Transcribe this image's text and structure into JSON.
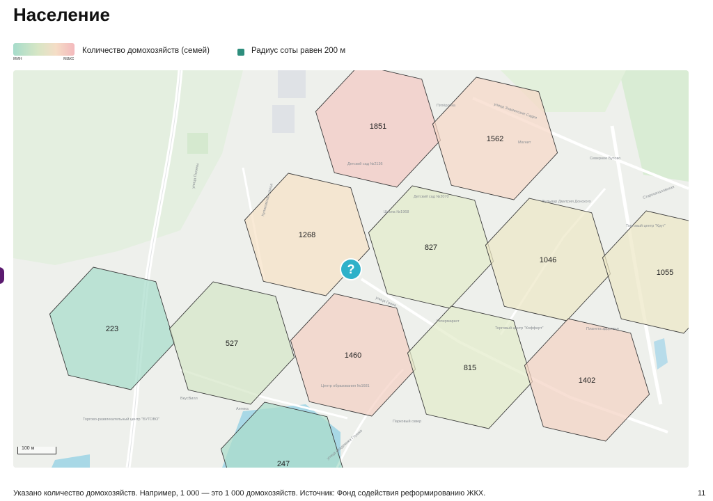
{
  "title": "Население",
  "legend": {
    "gradient_min": "мин",
    "gradient_max": "макс",
    "gradient_label": "Количество домохозяйств (семей)",
    "radius_label": "Радиус соты равен 200 м",
    "radius_color": "#2e8e7d"
  },
  "map": {
    "help_symbol": "?",
    "scale_label": "100 м",
    "hexes": [
      {
        "value": "1851",
        "color": "#f4c9c4"
      },
      {
        "value": "1562",
        "color": "#f6d8c8"
      },
      {
        "value": "1268",
        "color": "#f6e2c6"
      },
      {
        "value": "827",
        "color": "#e3ebcb"
      },
      {
        "value": "1046",
        "color": "#ede8c6"
      },
      {
        "value": "1055",
        "color": "#ede8c6"
      },
      {
        "value": "223",
        "color": "#a8dcca"
      },
      {
        "value": "527",
        "color": "#d6e6c8"
      },
      {
        "value": "1460",
        "color": "#f4d0c4"
      },
      {
        "value": "815",
        "color": "#e3ebcb"
      },
      {
        "value": "1402",
        "color": "#f4d3c4"
      },
      {
        "value": "247",
        "color": "#aadccb"
      }
    ],
    "street_labels": [
      "улица Знаменские Садки",
      "улица Поляны",
      "Куликовская улица",
      "улица Грина",
      "Бульвар Дмитрия Донского",
      "улица Академика Глушко",
      "Северное Бутово",
      "Старокачаловская"
    ],
    "poi_labels": [
      "Пятёрочка",
      "Магнит",
      "Детский сад №2136",
      "Детский сад №2070",
      "Школа №1968",
      "Гипермаркет",
      "Торговый центр \"Кофферт\"",
      "Торговый центр \"Круг\"",
      "Торгово-развлекательный центр \"БУТОВО\"",
      "Центр образования №1681",
      "Парковый сквер",
      "ВкусВилл",
      "Аптека",
      "Планета здоровья"
    ]
  },
  "footer": "Указано количество домохозяйств. Например, 1 000 — это 1 000 домохозяйств. Источник: Фонд содействия реформированию ЖКХ.",
  "page_number": "11"
}
